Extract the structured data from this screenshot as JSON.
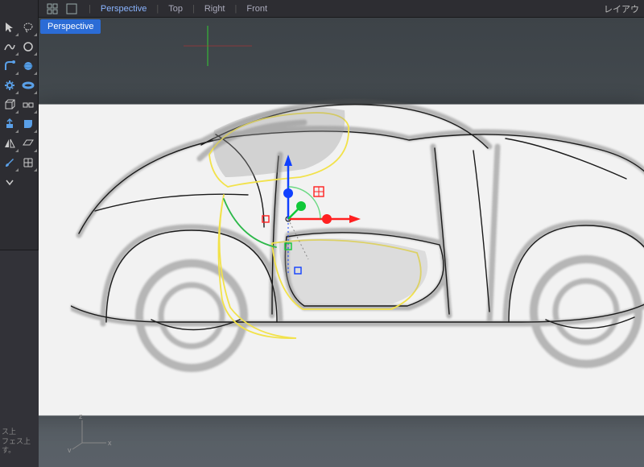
{
  "topbar": {
    "views": [
      "Perspective",
      "Top",
      "Right",
      "Front"
    ],
    "right_label": "レイアウ"
  },
  "active_view_badge": "Perspective",
  "tools": {
    "row1": [
      "arrow-icon",
      "lasso-icon"
    ],
    "row2": [
      "curve-icon",
      "rect-icon"
    ],
    "row3": [
      "fillet-icon",
      "sphere-icon"
    ],
    "row4": [
      "torus-icon",
      "pipe-icon"
    ],
    "row5": [
      "box-icon",
      "join-icon"
    ],
    "row6": [
      "extrude-icon",
      "sweep-icon"
    ],
    "row7": [
      "loft-icon",
      "plane-icon"
    ],
    "row8": [
      "brush-icon",
      "grid-icon"
    ],
    "row9": [
      "dropdown-icon",
      ""
    ]
  },
  "status": {
    "line1": "ス上",
    "line2": "フェス上",
    "line3": "す。"
  },
  "world_axes": {
    "x": "x",
    "y": "y",
    "z": "z"
  }
}
